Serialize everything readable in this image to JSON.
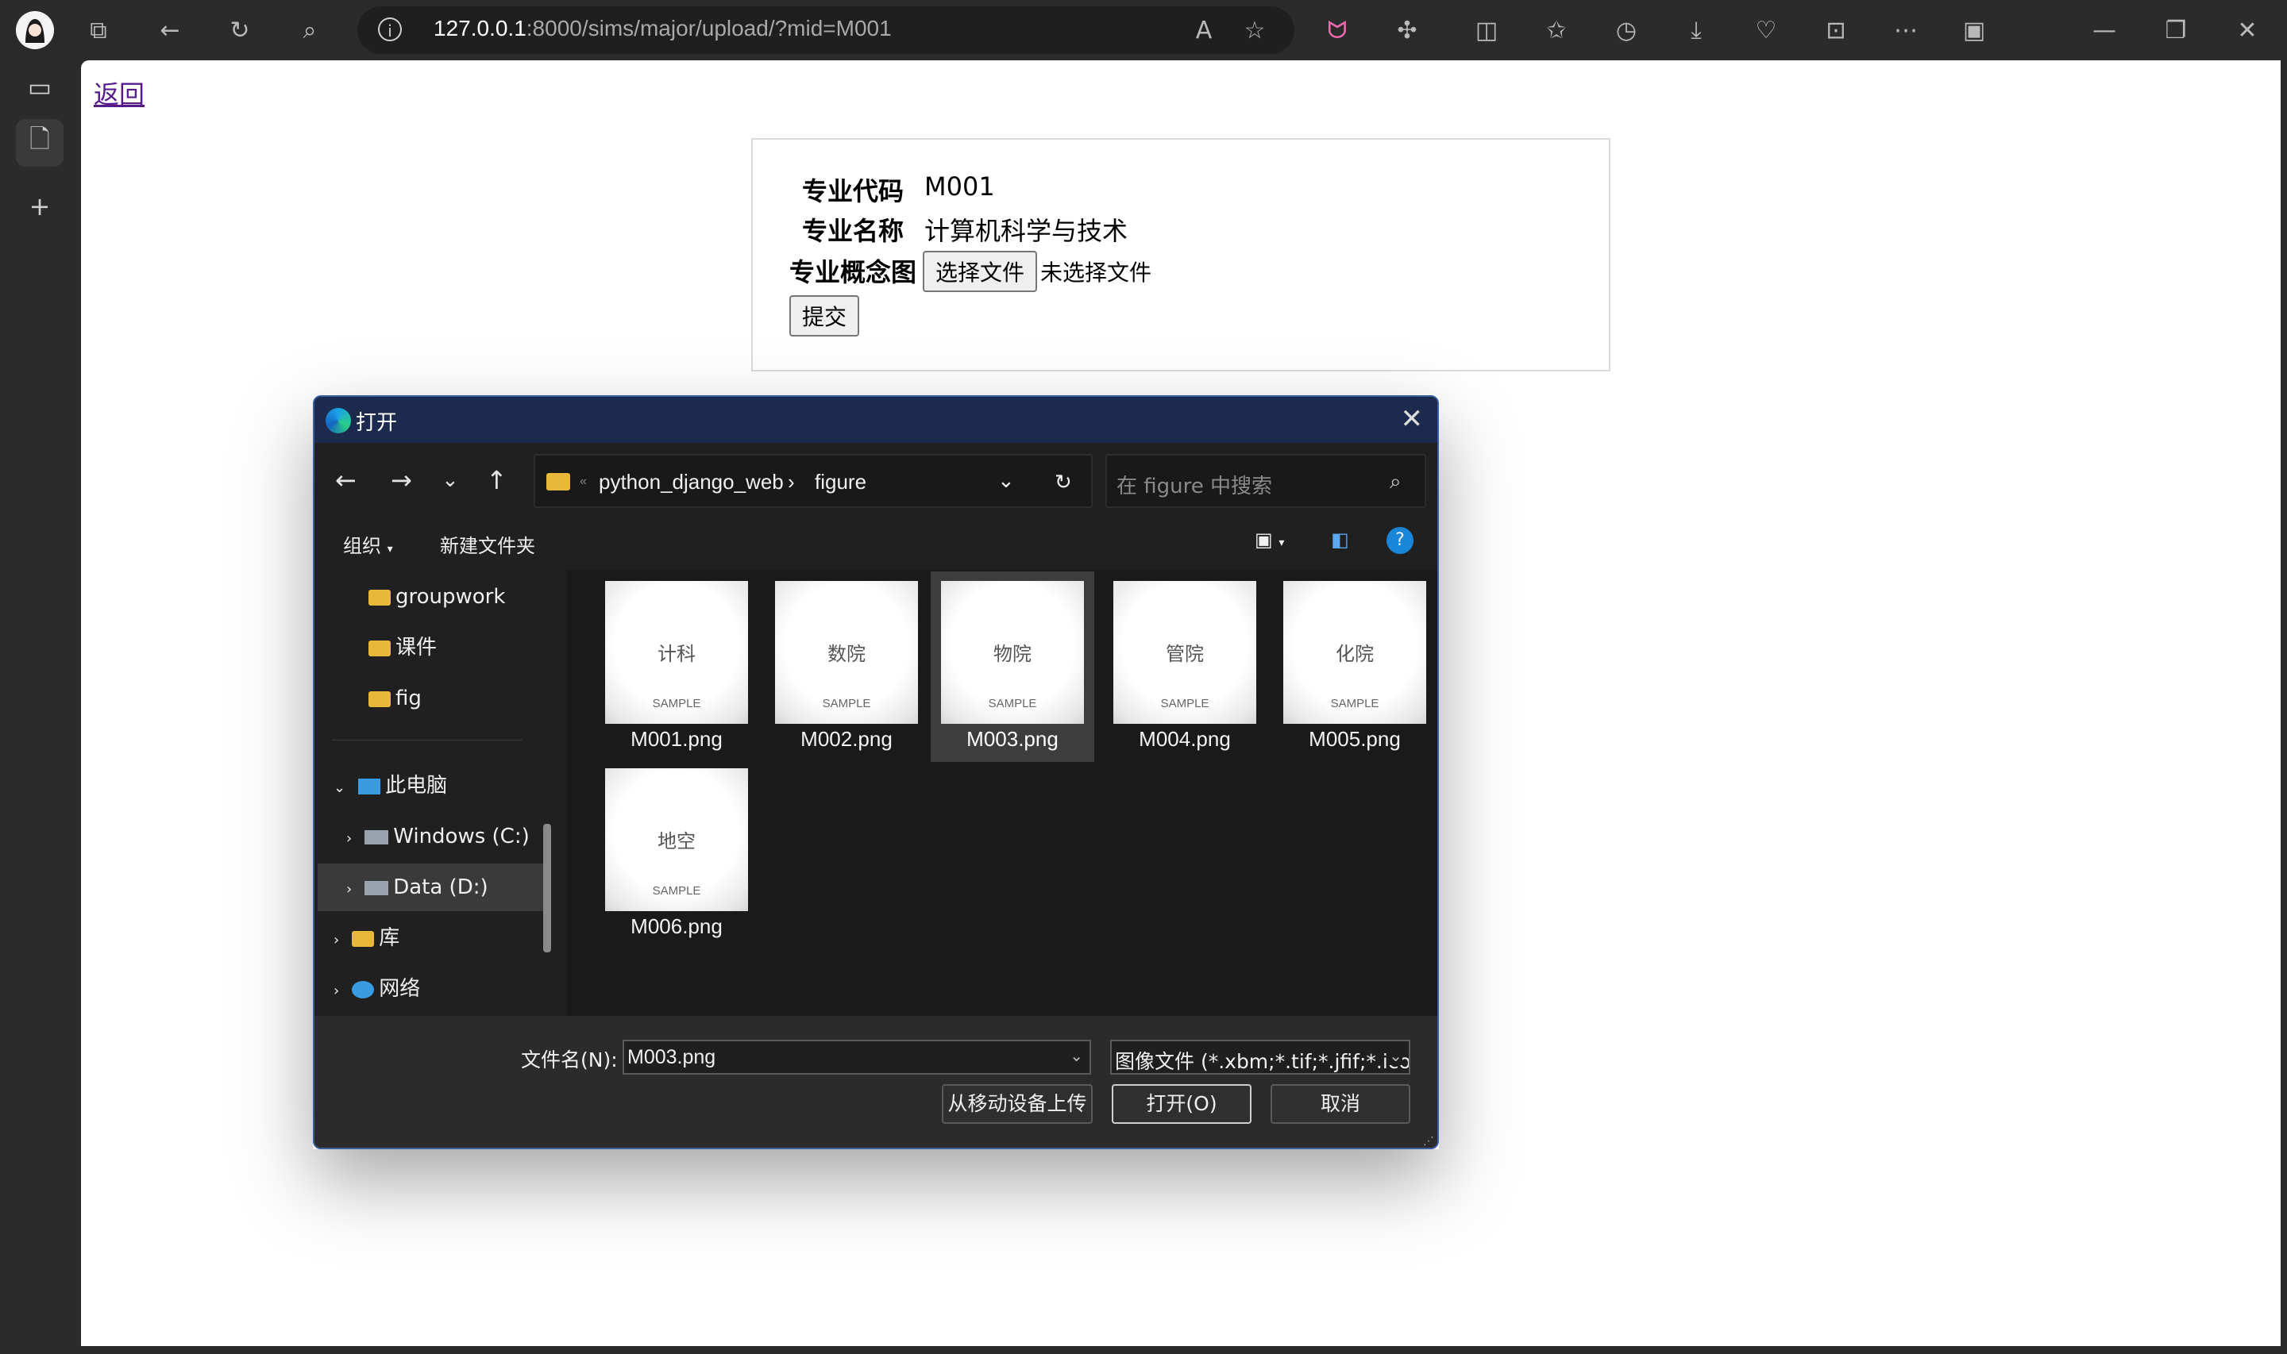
{
  "browser": {
    "url_host": "127.0.0.1",
    "url_rest": ":8000/sims/major/upload/?mid=M001"
  },
  "page": {
    "back_link": "返回",
    "form": {
      "code_label": "专业代码",
      "code_value": "M001",
      "name_label": "专业名称",
      "name_value": "计算机科学与技术",
      "image_label": "专业概念图",
      "choose_file_btn": "选择文件",
      "no_file_text": "未选择文件",
      "submit_btn": "提交"
    }
  },
  "dialog": {
    "title": "打开",
    "path": {
      "overflow": "«",
      "folder1": "python_django_web",
      "sep": "›",
      "folder2": "figure"
    },
    "search_placeholder": "在 figure 中搜索",
    "commands": {
      "organize": "组织",
      "new_folder": "新建文件夹"
    },
    "nav_items": {
      "groupwork": "groupwork",
      "courseware": "课件",
      "fig": "fig",
      "this_pc": "此电脑",
      "windows_c": "Windows (C:)",
      "data_d": "Data (D:)",
      "library": "库",
      "network": "网络"
    },
    "files": [
      {
        "name": "M001.png",
        "thumb_label": "计科",
        "thumb_sample": "SAMPLE"
      },
      {
        "name": "M002.png",
        "thumb_label": "数院",
        "thumb_sample": "SAMPLE"
      },
      {
        "name": "M003.png",
        "thumb_label": "物院",
        "thumb_sample": "SAMPLE"
      },
      {
        "name": "M004.png",
        "thumb_label": "管院",
        "thumb_sample": "SAMPLE"
      },
      {
        "name": "M005.png",
        "thumb_label": "化院",
        "thumb_sample": "SAMPLE"
      },
      {
        "name": "M006.png",
        "thumb_label": "地空",
        "thumb_sample": "SAMPLE"
      }
    ],
    "footer": {
      "filename_label": "文件名(N):",
      "filename_value": "M003.png",
      "filetype_value": "图像文件 (*.xbm;*.tif;*.jfif;*.ico;",
      "upload_mobile_btn": "从移动设备上传",
      "open_btn": "打开(O)",
      "cancel_btn": "取消"
    }
  },
  "colors": {
    "accent_help": "#1a86d9",
    "folder": "#e8b83a",
    "link": "#551a8b"
  }
}
